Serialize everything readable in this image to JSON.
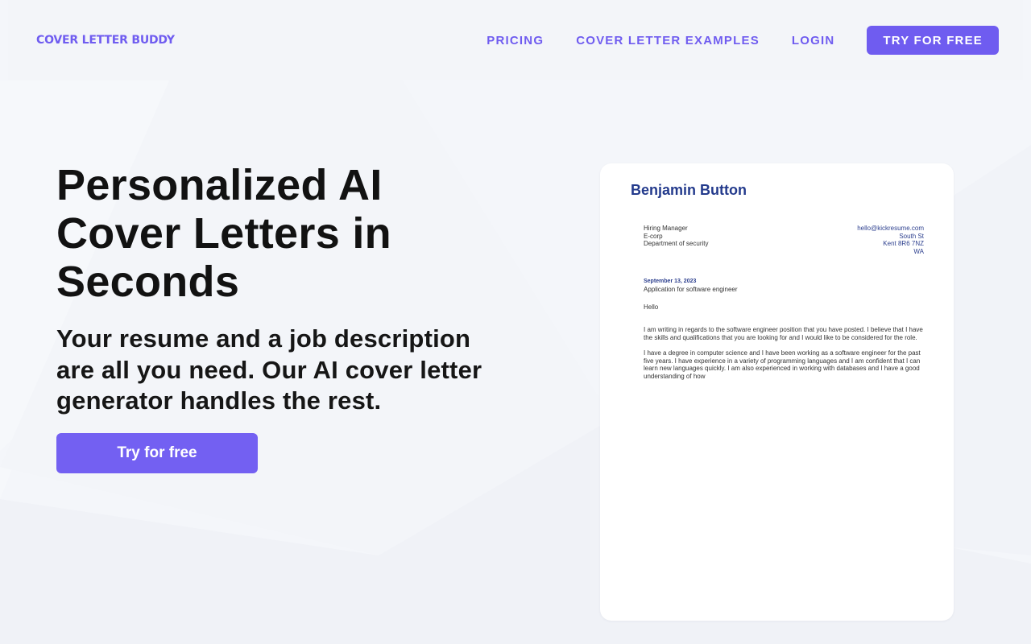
{
  "brand": {
    "logo": "COVER LETTER BUDDY",
    "accent": "#6f5cf0"
  },
  "nav": {
    "links": [
      "PRICING",
      "COVER LETTER EXAMPLES",
      "LOGIN"
    ],
    "cta": "TRY FOR FREE"
  },
  "hero": {
    "title": "Personalized AI Cover Letters in Seconds",
    "subtitle": "Your resume and a job description are all you need. Our AI cover letter generator handles the rest.",
    "button": "Try for free"
  },
  "letter": {
    "name": "Benjamin Button",
    "recipient": [
      "Hiring Manager",
      "E-corp",
      "Department of security"
    ],
    "sender": [
      "hello@kickresume.com",
      "South St",
      "Kent 8R6 7NZ",
      "WA"
    ],
    "date": "September 13, 2023",
    "subject": "Application for software engineer",
    "greeting": "Hello",
    "paragraphs": [
      "I am writing in regards to the software engineer position that you have posted. I believe that I have the skills and qualifications that you are looking for and I would like to be considered for the role.",
      "I have a degree in computer science and I have been working as a software engineer for the past five years. I have experience in a variety of programming languages and I am confident that I can learn new languages quickly. I am also experienced in working with databases and I have a good understanding of how"
    ]
  }
}
